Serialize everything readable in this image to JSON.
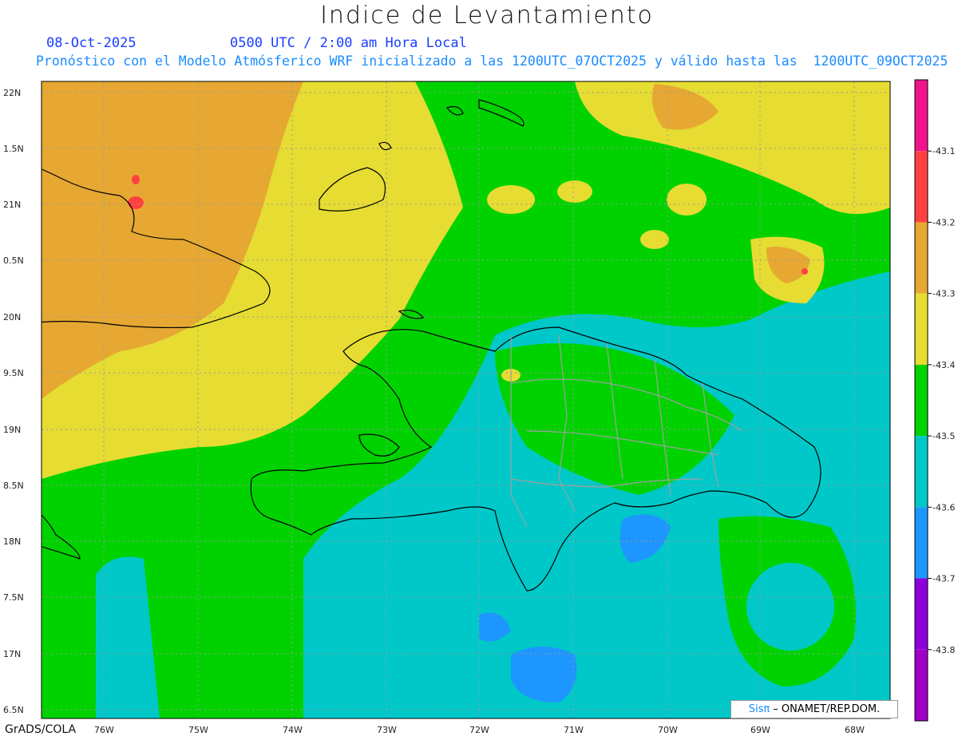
{
  "title": "Indice de Levantamiento",
  "date": "08-Oct-2025",
  "time": "0500 UTC / 2:00 am Hora Local",
  "subtitle": "Pronóstico con el Modelo Atmósferico WRF inicializado a las 1200UTC_07OCT2025 y válido hasta las  1200UTC_09OCT2025",
  "lat_labels": [
    "22N",
    "1.5N",
    "21N",
    "0.5N",
    "20N",
    "9.5N",
    "19N",
    "8.5N",
    "18N",
    "7.5N",
    "17N",
    "6.5N"
  ],
  "lon_labels": [
    "76W",
    "75W",
    "74W",
    "73W",
    "72W",
    "71W",
    "70W",
    "69W",
    "68W"
  ],
  "colorbar": {
    "labels": [
      "-43.1",
      "-43.2",
      "-43.3",
      "-43.4",
      "-43.5",
      "-43.6",
      "-43.7",
      "-43.8"
    ],
    "colors": [
      "#f0148c",
      "#ff4040",
      "#e6a832",
      "#e6dc32",
      "#00d200",
      "#00c8c8",
      "#1e96ff",
      "#8c00dc",
      "#a000c8"
    ]
  },
  "credit": {
    "brand": "Sisπ",
    "text": "– ONAMET/REP.DOM."
  },
  "footer": "GrADS/COLA",
  "colors": {
    "orange": "#e6a832",
    "yellow": "#e6dc32",
    "green": "#00d200",
    "cyan": "#00c8c8",
    "blue": "#1e96ff",
    "red": "#ff4040"
  }
}
